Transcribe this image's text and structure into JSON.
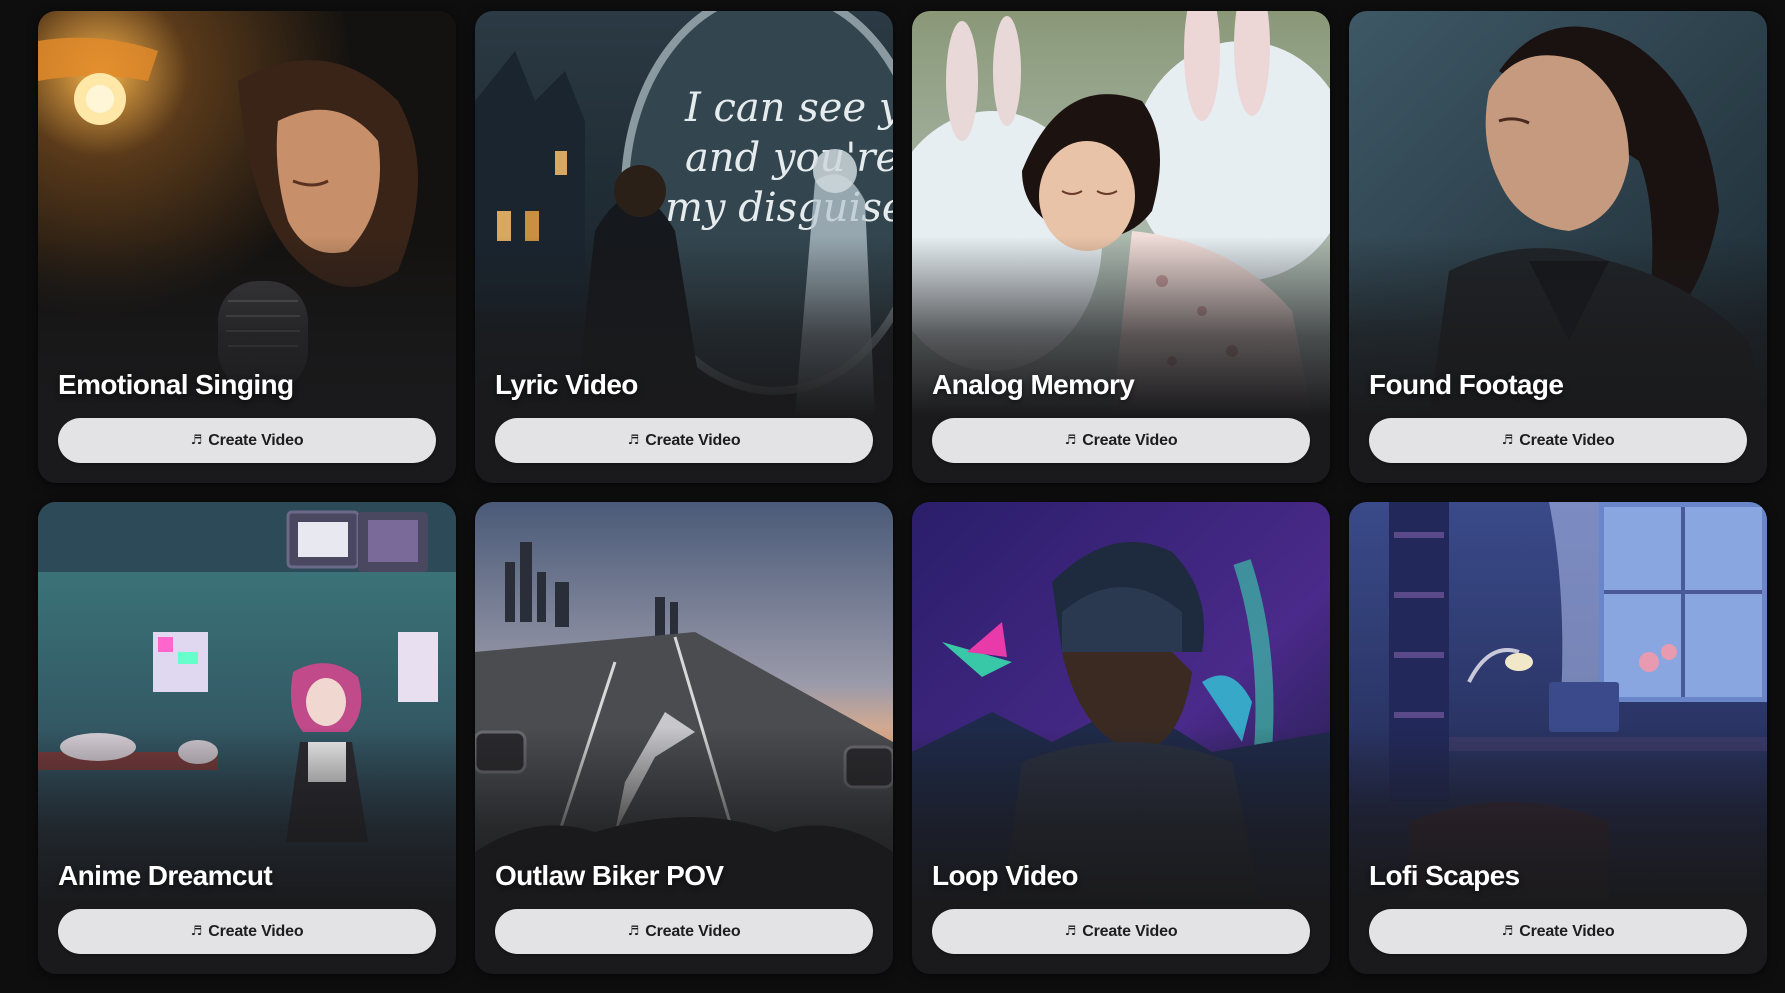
{
  "cards": [
    {
      "title": "Emotional Singing",
      "button_label": "Create Video",
      "button_icon": "music-note-icon"
    },
    {
      "title": "Lyric Video",
      "button_label": "Create Video",
      "button_icon": "music-note-icon",
      "art_text": "I can see you and you're my disguise"
    },
    {
      "title": "Analog Memory",
      "button_label": "Create Video",
      "button_icon": "music-note-icon"
    },
    {
      "title": "Found Footage",
      "button_label": "Create Video",
      "button_icon": "music-note-icon"
    },
    {
      "title": "Anime Dreamcut",
      "button_label": "Create Video",
      "button_icon": "music-note-icon"
    },
    {
      "title": "Outlaw Biker POV",
      "button_label": "Create Video",
      "button_icon": "music-note-icon"
    },
    {
      "title": "Loop Video",
      "button_label": "Create Video",
      "button_icon": "music-note-icon"
    },
    {
      "title": "Lofi Scapes",
      "button_label": "Create Video",
      "button_icon": "music-note-icon"
    }
  ],
  "colors": {
    "page_background": "#0e0e0f",
    "card_background": "#1a1a1c",
    "button_background": "#e3e3e5",
    "button_text": "#1d1d1f",
    "title_text": "#ffffff"
  }
}
